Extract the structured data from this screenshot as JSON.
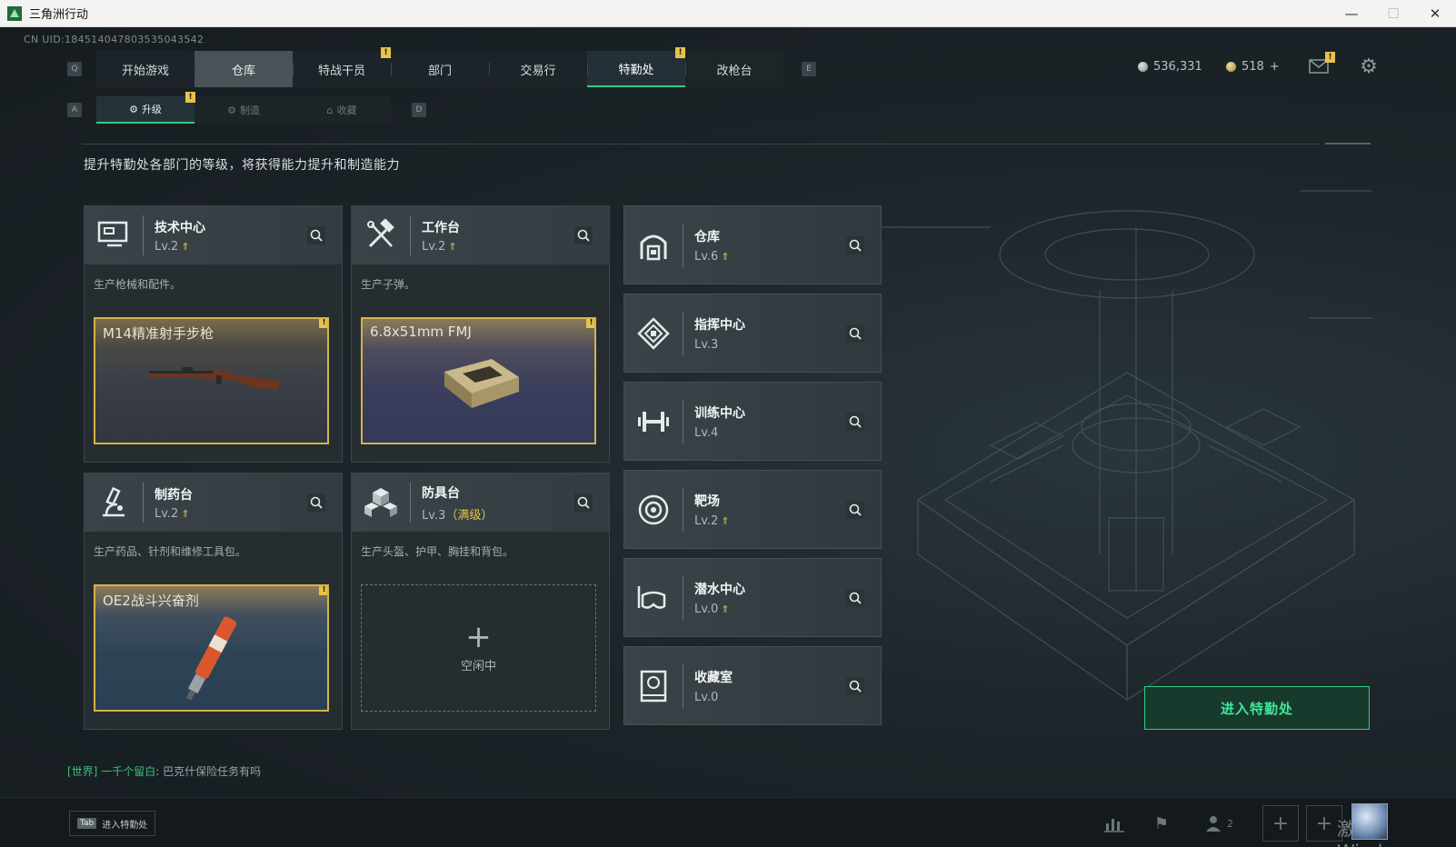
{
  "window": {
    "title": "三角洲行动"
  },
  "uid": "CN UID:1845140478035350435​42",
  "nav": {
    "key_left": "Q",
    "key_right": "E",
    "tabs": [
      "开始游戏",
      "仓库",
      "特战干员",
      "部门",
      "交易行",
      "特勤处",
      "改枪台"
    ],
    "badges": [
      "!",
      "!"
    ]
  },
  "currency": {
    "silver": "536,331",
    "gold": "518",
    "gold_add": "+"
  },
  "subnav": {
    "key_left": "A",
    "key_right": "D",
    "tabs": [
      "升级",
      "制造",
      "收藏"
    ],
    "badge": "!"
  },
  "intro": "提升特勤处各部门的等级，将获得能力提升和制造能力",
  "cards": [
    {
      "name": "技术中心",
      "level": "Lv.2",
      "desc": "生产枪械和配件。",
      "item": "M14精准射手步枪",
      "flag": "!"
    },
    {
      "name": "工作台",
      "level": "Lv.2",
      "desc": "生产子弹。",
      "item": "6.8x51mm FMJ",
      "flag": "!"
    },
    {
      "name": "制药台",
      "level": "Lv.2",
      "desc": "生产药品、针剂和维修工具包。",
      "item": "OE2战斗兴奋剂",
      "flag": "!"
    },
    {
      "name": "防具台",
      "level": "Lv.3",
      "level_max": "（满级）",
      "desc": "生产头盔、护甲、胸挂和背包。",
      "idle": "空闲中"
    }
  ],
  "side_cards": [
    {
      "name": "仓库",
      "level": "Lv.6"
    },
    {
      "name": "指挥中心",
      "level": "Lv.3"
    },
    {
      "name": "训练中心",
      "level": "Lv.4"
    },
    {
      "name": "靶场",
      "level": "Lv.2"
    },
    {
      "name": "潜水中心",
      "level": "Lv.0"
    },
    {
      "name": "收藏室",
      "level": "Lv.0"
    }
  ],
  "enter_button": "进入特勤处",
  "chat": {
    "channel": "[世界]",
    "sender": "一千个留白",
    "message": "巴克什保险任务有吗"
  },
  "bottom": {
    "tab_key": "Tab",
    "tab_label": "进入特勤处",
    "friends_count": "2",
    "watermark": "激活 Windows"
  },
  "colors": {
    "accent": "#2fcf86",
    "alert": "#e6c34a",
    "item_border": "#d4b34a"
  }
}
